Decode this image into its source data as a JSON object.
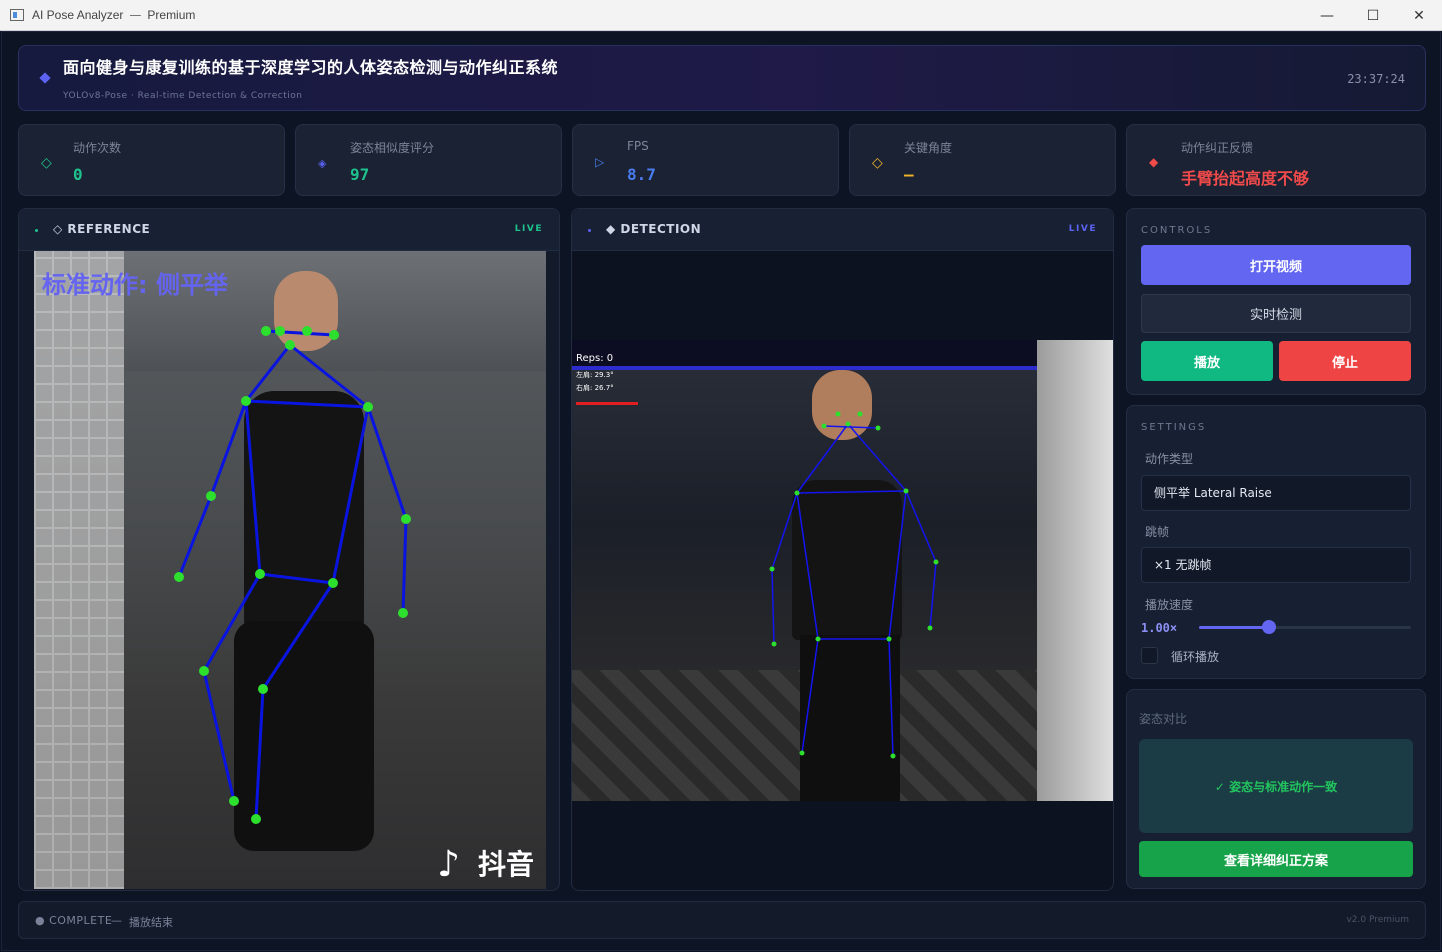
{
  "window": {
    "title": "AI Pose Analyzer",
    "edition": "Premium",
    "minimize": "—",
    "maximize": "☐",
    "close": "✕"
  },
  "header": {
    "title": "面向健身与康复训练的基于深度学习的人体姿态检测与动作纠正系统",
    "subtitle": "YOLOv8-Pose  ·  Real-time Detection & Correction",
    "clock": "23:37:24"
  },
  "stats": [
    {
      "label": "动作次数",
      "value": "0",
      "icon": "diamond-outline-icon",
      "color": "#1fc28c"
    },
    {
      "label": "姿态相似度评分",
      "value": "97",
      "icon": "diamond-dot-icon",
      "color": "#1fc28c"
    },
    {
      "label": "FPS",
      "value": "8.7",
      "icon": "play-outline-icon",
      "color": "#4a7cf0"
    },
    {
      "label": "关键角度",
      "value": "–",
      "icon": "diamond-outline-icon",
      "color": "#f0b429"
    },
    {
      "label": "动作纠正反馈",
      "value": "手臂抬起高度不够",
      "icon": "diamond-filled-icon",
      "color": "#f04a4a"
    }
  ],
  "reference": {
    "title": "◇ REFERENCE",
    "live": "LIVE",
    "overlay": "标准动作: 侧平举",
    "watermark": "抖音"
  },
  "detection": {
    "title": "◆ DETECTION",
    "live": "LIVE",
    "reps": "Reps: 0",
    "left_angle": "左肩: 29.3°",
    "right_angle": "右肩: 26.7°"
  },
  "controls": {
    "caption": "CONTROLS",
    "open_video": "打开视频",
    "realtime": "实时检测",
    "play": "播放",
    "stop": "停止"
  },
  "settings": {
    "caption": "SETTINGS",
    "action_label": "动作类型",
    "action_value": "侧平举  Lateral Raise",
    "skip_label": "跳帧",
    "skip_value": "×1  无跳帧",
    "speed_label": "播放速度",
    "speed_value": "1.00×",
    "speed_fraction": 0.33,
    "loop_label": "循环播放"
  },
  "compare": {
    "caption": "姿态对比",
    "result": "✓  姿态与标准动作一致",
    "details_button": "查看详细纠正方案"
  },
  "status": {
    "state": "● COMPLETE",
    "dash": "—",
    "message": "播放结束",
    "version": "v2.0  Premium"
  }
}
